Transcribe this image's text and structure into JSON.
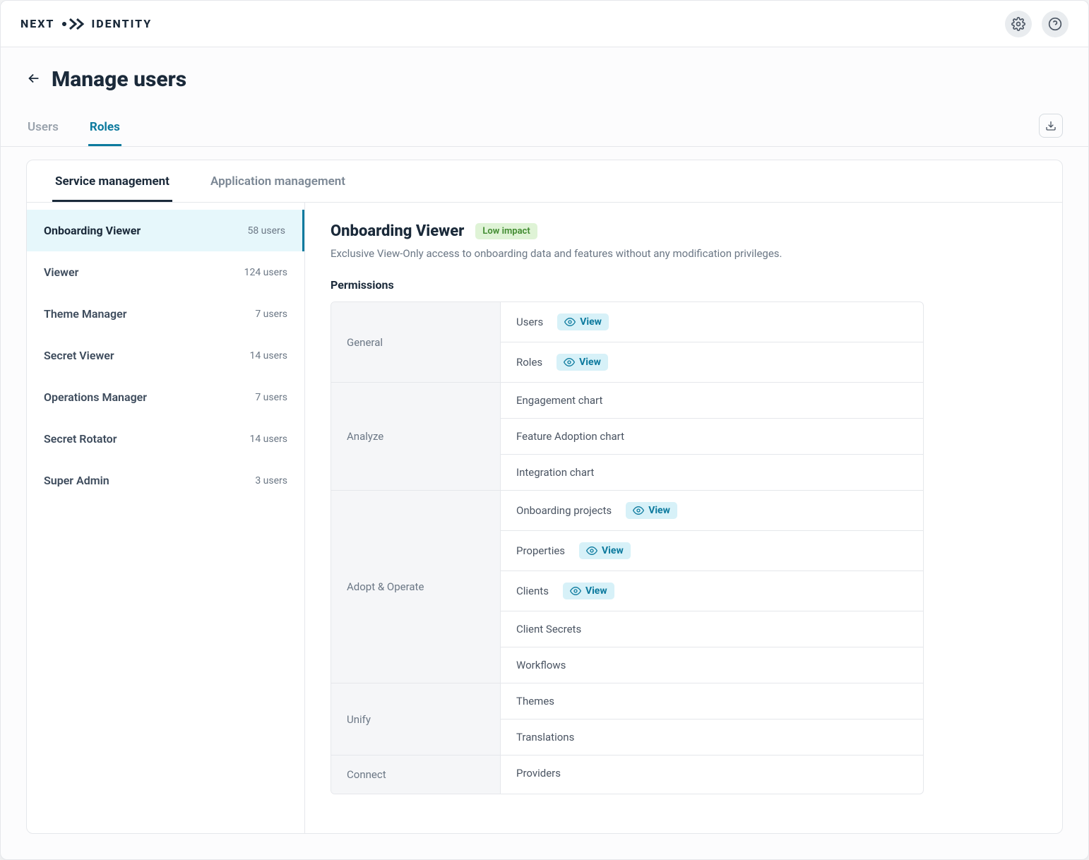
{
  "brand": {
    "left": "NEXT",
    "right": "IDENTITY"
  },
  "header": {
    "title": "Manage users"
  },
  "primary_tabs": [
    {
      "label": "Users",
      "active": false
    },
    {
      "label": "Roles",
      "active": true
    }
  ],
  "secondary_tabs": [
    {
      "label": "Service management",
      "active": true
    },
    {
      "label": "Application management",
      "active": false
    }
  ],
  "roles": [
    {
      "name": "Onboarding Viewer",
      "count": "58 users",
      "active": true
    },
    {
      "name": "Viewer",
      "count": "124 users",
      "active": false
    },
    {
      "name": "Theme Manager",
      "count": "7 users",
      "active": false
    },
    {
      "name": "Secret Viewer",
      "count": "14 users",
      "active": false
    },
    {
      "name": "Operations Manager",
      "count": "7 users",
      "active": false
    },
    {
      "name": "Secret Rotator",
      "count": "14 users",
      "active": false
    },
    {
      "name": "Super Admin",
      "count": "3 users",
      "active": false
    }
  ],
  "detail": {
    "title": "Onboarding Viewer",
    "impact": "Low impact",
    "description": "Exclusive View-Only access to onboarding data and features without any modification privileges.",
    "permissions_heading": "Permissions",
    "view_label": "View",
    "groups": [
      {
        "name": "General",
        "items": [
          {
            "label": "Users",
            "view": true
          },
          {
            "label": "Roles",
            "view": true
          }
        ]
      },
      {
        "name": "Analyze",
        "items": [
          {
            "label": "Engagement chart",
            "view": false
          },
          {
            "label": "Feature Adoption chart",
            "view": false
          },
          {
            "label": "Integration chart",
            "view": false
          }
        ]
      },
      {
        "name": "Adopt & Operate",
        "items": [
          {
            "label": "Onboarding projects",
            "view": true
          },
          {
            "label": "Properties",
            "view": true
          },
          {
            "label": "Clients",
            "view": true
          },
          {
            "label": "Client Secrets",
            "view": false
          },
          {
            "label": "Workflows",
            "view": false
          }
        ]
      },
      {
        "name": "Unify",
        "items": [
          {
            "label": "Themes",
            "view": false
          },
          {
            "label": "Translations",
            "view": false
          }
        ]
      },
      {
        "name": "Connect",
        "items": [
          {
            "label": "Providers",
            "view": false
          }
        ]
      }
    ]
  }
}
